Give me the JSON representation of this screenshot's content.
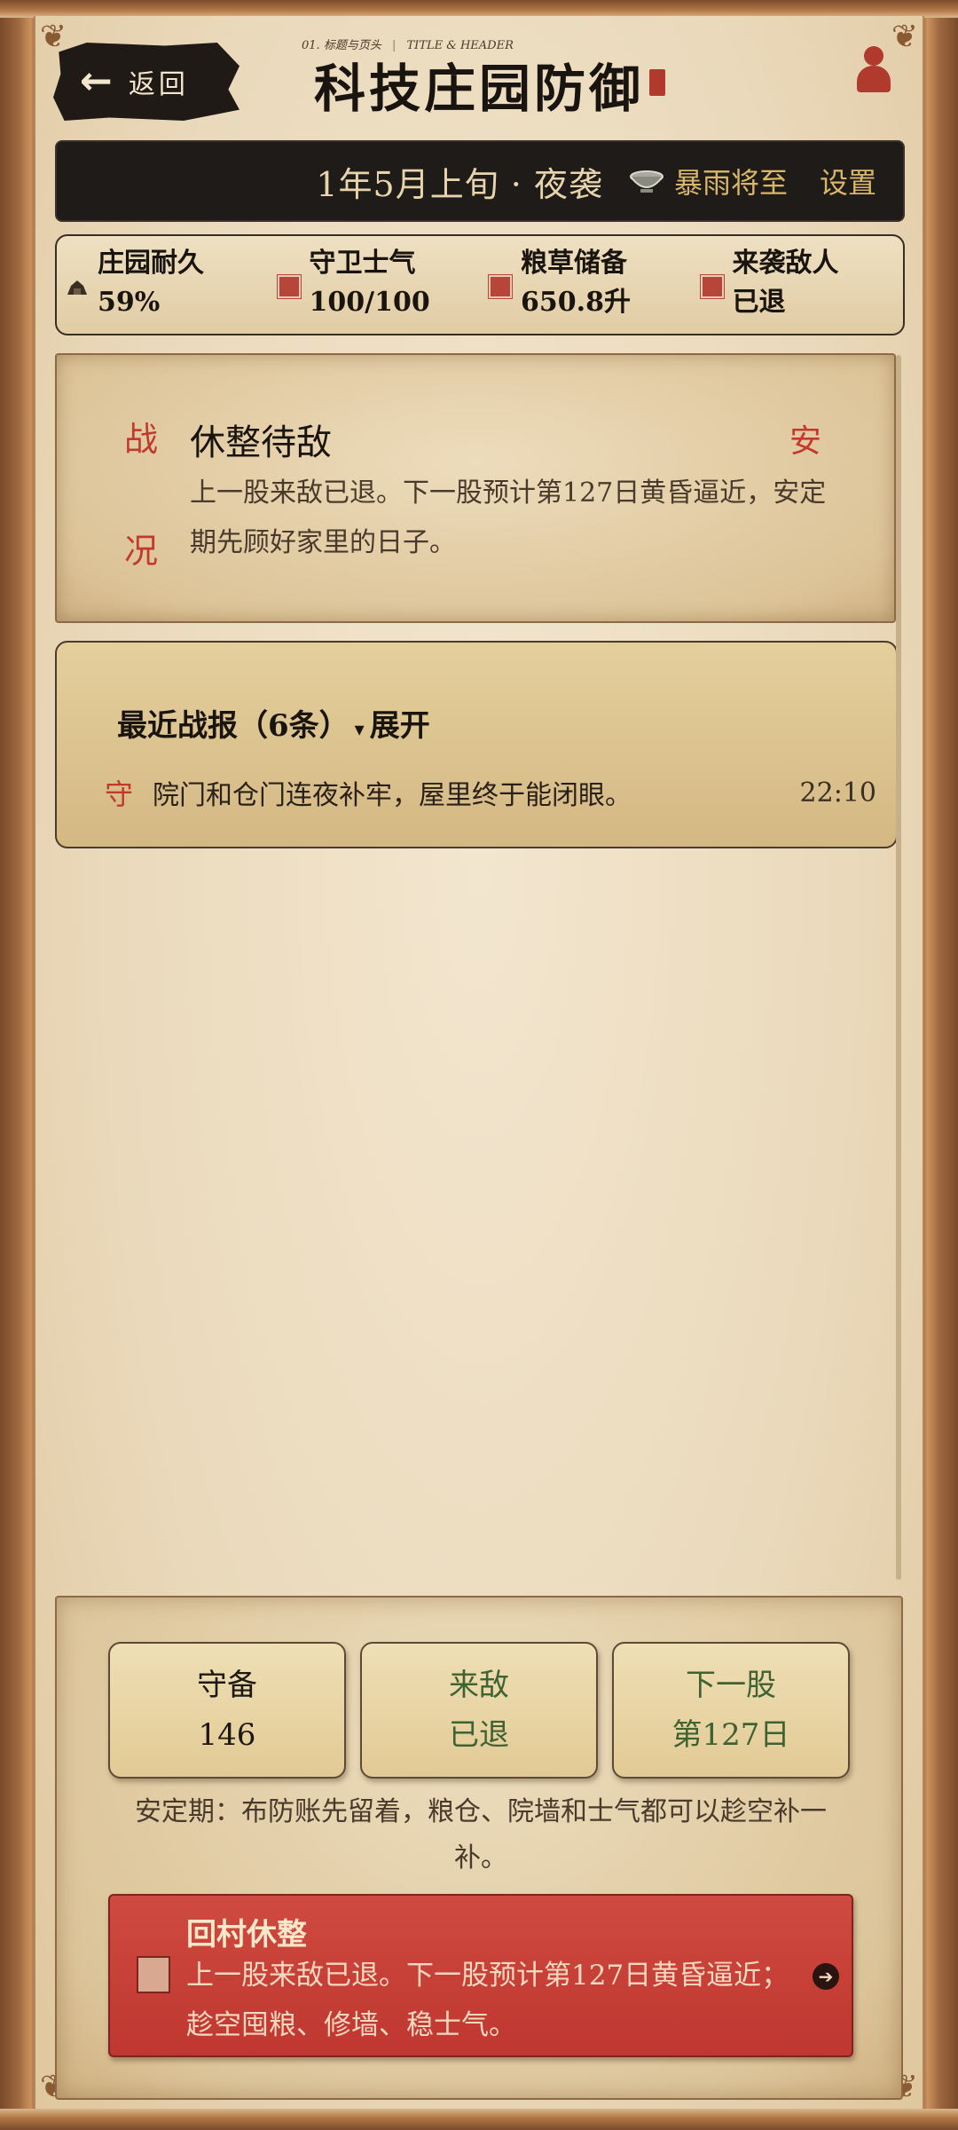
{
  "header": {
    "section_num": "01.",
    "section_cn": "标题与页头",
    "section_en": "TITLE & HEADER",
    "back_label": "返回",
    "title": "科技庄园防御"
  },
  "status_bar": {
    "date_phase": "1年5月上旬 · 夜袭",
    "weather_icon": "bowl-icon",
    "weather": "暴雨将至",
    "settings": "设置"
  },
  "stats": [
    {
      "label": "庄园耐久",
      "value": "59%",
      "icon": "manor-icon"
    },
    {
      "label": "守卫士气",
      "value": "100/100",
      "icon": "seal-icon"
    },
    {
      "label": "粮草储备",
      "value": "650.8升",
      "icon": "seal-icon"
    },
    {
      "label": "来袭敌人",
      "value": "已退",
      "icon": "seal-icon"
    }
  ],
  "situation": {
    "tag_top": "战",
    "tag_bottom": "况",
    "title": "休整待敌",
    "badge": "安",
    "description": "上一股来敌已退。下一股预计第127日黄昏逼近，安定期先顾好家里的日子。"
  },
  "reports": {
    "header": "最近战报（6条）",
    "expand": "展开",
    "items": [
      {
        "tag": "守",
        "text": "院门和仓门连夜补牢，屋里终于能闭眼。",
        "time": "22:10"
      }
    ]
  },
  "summary": {
    "cards": [
      {
        "top": "守备",
        "bottom": "146"
      },
      {
        "top": "来敌",
        "bottom": "已退"
      },
      {
        "top": "下一股",
        "bottom": "第127日"
      }
    ],
    "note": "安定期：布防账先留着，粮仓、院墙和士气都可以趁空补一补。",
    "action": {
      "title": "回村休整",
      "description": "上一股来敌已退。下一股预计第127日黄昏逼近；趁空囤粮、修墙、稳士气。"
    }
  },
  "colors": {
    "accent_red": "#c23a2e",
    "gold": "#d8b76a",
    "green": "#3f6233",
    "dark_bar": "#1f1b18"
  }
}
